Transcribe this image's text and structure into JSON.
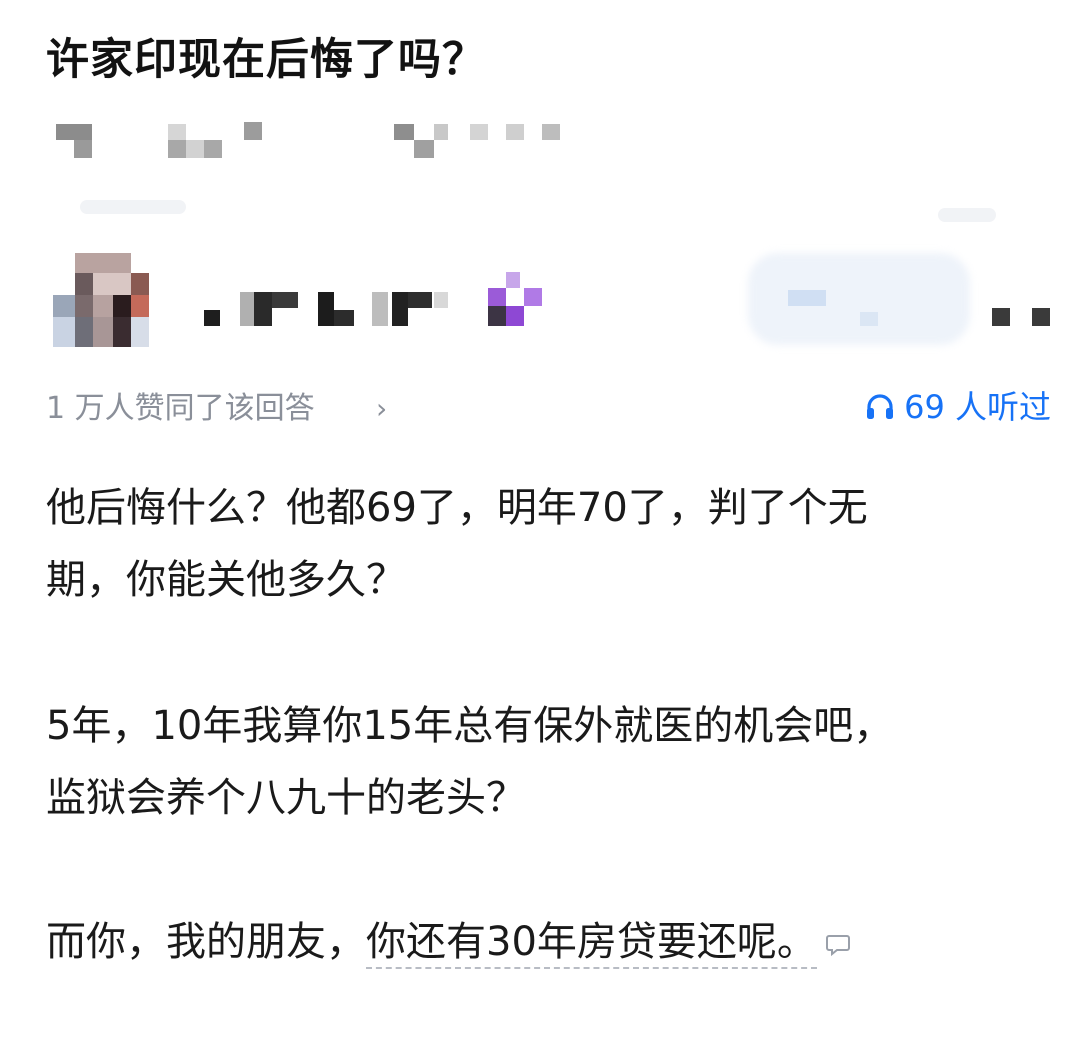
{
  "question": {
    "title": "许家印现在后悔了吗？"
  },
  "answer_meta": {
    "agree_text": "1 万人赞同了该回答",
    "agree_chevron": "›",
    "listen_count_text": "69 人听过",
    "listen_icon": "headphones-icon",
    "accent_color": "#1772f6"
  },
  "answer": {
    "paragraph1_line1": "他后悔什么？他都69了，明年70了，判了个无",
    "paragraph1_line2": "期，你能关他多久？",
    "paragraph2_line1": "5年，10年我算你15年总有保外就医的机会吧，",
    "paragraph2_line2": "监狱会养个八九十的老头？",
    "paragraph3_plain": "而你，我的朋友，",
    "paragraph3_underlined": "你还有30年房贷要还呢。",
    "comment_icon": "comment-bubble-icon"
  }
}
